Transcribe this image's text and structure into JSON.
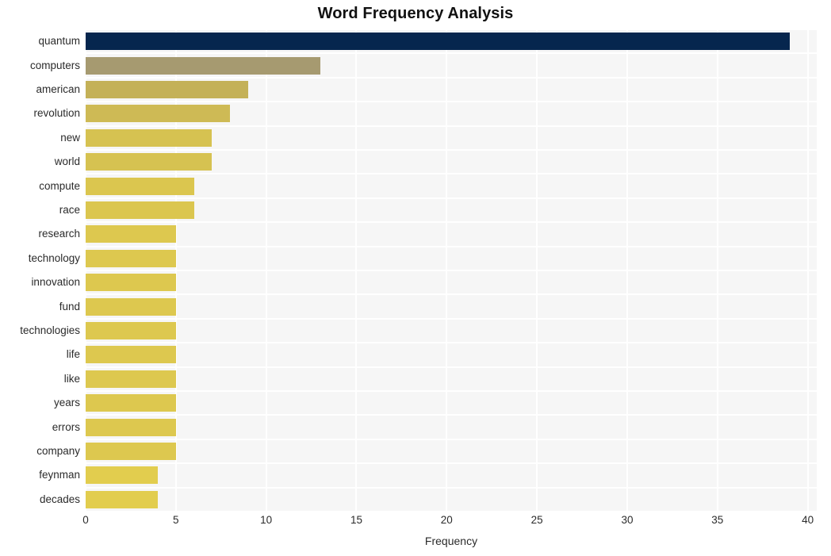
{
  "chart_data": {
    "type": "bar",
    "orientation": "horizontal",
    "title": "Word Frequency Analysis",
    "xlabel": "Frequency",
    "ylabel": "",
    "categories": [
      "quantum",
      "computers",
      "american",
      "revolution",
      "new",
      "world",
      "compute",
      "race",
      "research",
      "technology",
      "innovation",
      "fund",
      "technologies",
      "life",
      "like",
      "years",
      "errors",
      "company",
      "feynman",
      "decades"
    ],
    "values": [
      39,
      13,
      9,
      8,
      7,
      7,
      6,
      6,
      5,
      5,
      5,
      5,
      5,
      5,
      5,
      5,
      5,
      5,
      4,
      4
    ],
    "bar_colors": [
      "#06264e",
      "#a69a70",
      "#c4b158",
      "#ceba55",
      "#d6c251",
      "#d6c251",
      "#dbc64f",
      "#dbc64f",
      "#ddc84f",
      "#ddc84f",
      "#ddc84f",
      "#ddc84f",
      "#ddc84f",
      "#ddc84f",
      "#ddc84f",
      "#ddc84f",
      "#ddc84f",
      "#ddc84f",
      "#e2cd4e",
      "#e2cd4e"
    ],
    "xlim": [
      0,
      40.5
    ],
    "xticks": [
      0,
      5,
      10,
      15,
      20,
      25,
      30,
      35,
      40
    ],
    "xtick_labels": [
      "0",
      "5",
      "10",
      "15",
      "20",
      "25",
      "30",
      "35",
      "40"
    ],
    "grid": true,
    "grid_color": "#ffffff",
    "plot_background": "#f6f6f6",
    "figure_background": "#ffffff",
    "legend": null,
    "legend_position": "none"
  }
}
